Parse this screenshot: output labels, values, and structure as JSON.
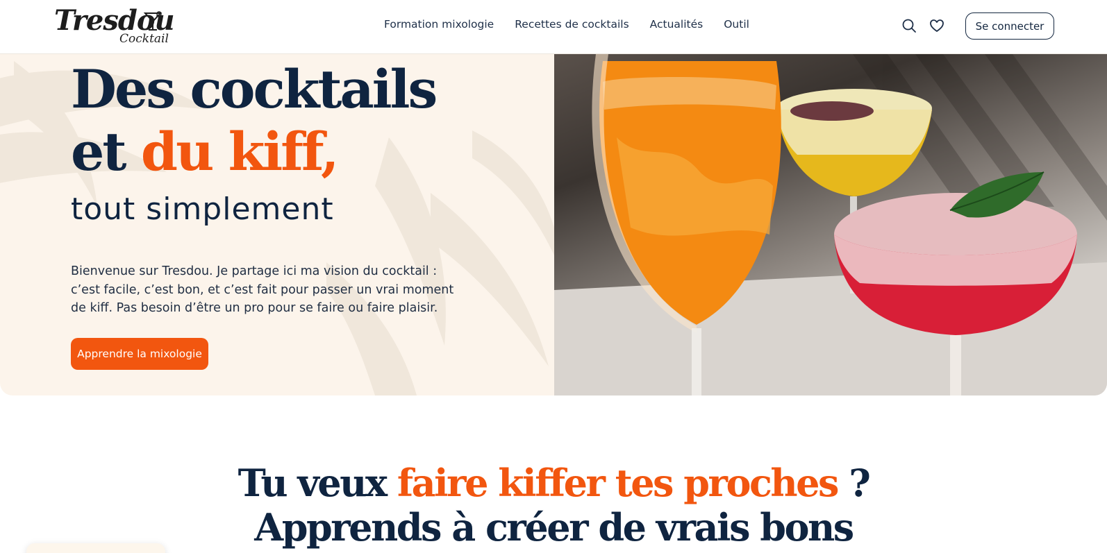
{
  "brand": {
    "name": "Tresdou",
    "sub": "Cocktail"
  },
  "nav": {
    "items": [
      {
        "label": "Formation mixologie"
      },
      {
        "label": "Recettes de cocktails"
      },
      {
        "label": "Actualités"
      },
      {
        "label": "Outil"
      }
    ]
  },
  "header": {
    "search_icon": "search-icon",
    "heart_icon": "heart-icon",
    "login_label": "Se connecter"
  },
  "hero": {
    "title_line1": "Des cocktails",
    "title_line2_prefix": "et ",
    "title_line2_accent": "du kiff,",
    "tagline": "tout simplement",
    "text": "Bienvenue sur Tresdou. Je partage ici ma vision du cocktail : c’est facile, c’est bon, et c’est fait pour passer un vrai moment de kiff. Pas besoin d’être un pro pour se faire ou faire plaisir.",
    "cta_label": "Apprendre la mixologie"
  },
  "section": {
    "heading_prefix": "Tu veux ",
    "heading_accent": "faire kiffer tes proches",
    "heading_suffix": " ?",
    "heading_line2": "Apprends à créer de vrais bons"
  },
  "colors": {
    "accent": "#f2560f",
    "navy": "#0f2440",
    "cream": "#fcf4eb"
  }
}
